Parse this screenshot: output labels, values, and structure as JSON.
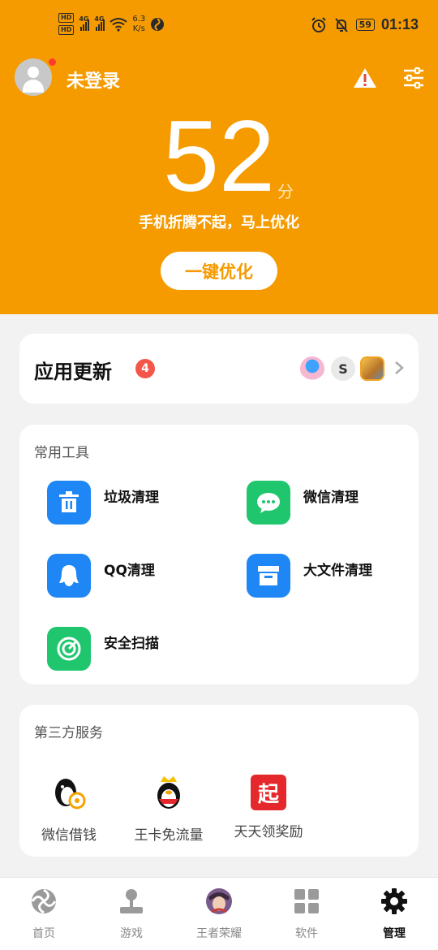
{
  "status_bar": {
    "network_speed": "6.3",
    "network_speed_unit": "K/s",
    "battery": "59",
    "time": "01:13",
    "hd1": "HD",
    "hd2": "HD",
    "net1": "4G",
    "net2": "4G"
  },
  "header": {
    "login_status": "未登录",
    "score": "52",
    "score_unit": "分",
    "score_message": "手机折腾不起，马上优化",
    "optimize_button": "一键优化",
    "accent_color": "#f59b00"
  },
  "app_update": {
    "title": "应用更新",
    "badge_count": "4",
    "icons": [
      "translate-app-icon",
      "s-app-icon",
      "game-app-icon"
    ]
  },
  "tools": {
    "title": "常用工具",
    "items": [
      {
        "label": "垃圾清理",
        "icon": "trash-icon",
        "color": "#1e86f5"
      },
      {
        "label": "微信清理",
        "icon": "wechat-icon",
        "color": "#20c66e"
      },
      {
        "label": "QQ清理",
        "icon": "qq-penguin-icon",
        "color": "#1e86f5"
      },
      {
        "label": "大文件清理",
        "icon": "archive-box-icon",
        "color": "#1e86f5"
      },
      {
        "label": "安全扫描",
        "icon": "radar-scan-icon",
        "color": "#20c66e"
      }
    ]
  },
  "services": {
    "title": "第三方服务",
    "items": [
      {
        "label": "微信借钱",
        "icon": "penguin-coin-icon"
      },
      {
        "label": "王卡免流量",
        "icon": "king-penguin-icon"
      },
      {
        "label": "天天领奖励",
        "icon": "qi-red-icon",
        "glyph": "起"
      }
    ]
  },
  "nav": {
    "items": [
      {
        "label": "首页",
        "icon": "home-orbit-icon"
      },
      {
        "label": "游戏",
        "icon": "joystick-icon"
      },
      {
        "label": "王者荣耀",
        "icon": "game-avatar-icon"
      },
      {
        "label": "软件",
        "icon": "grid-apps-icon"
      },
      {
        "label": "管理",
        "icon": "gear-icon",
        "active": true
      }
    ]
  }
}
